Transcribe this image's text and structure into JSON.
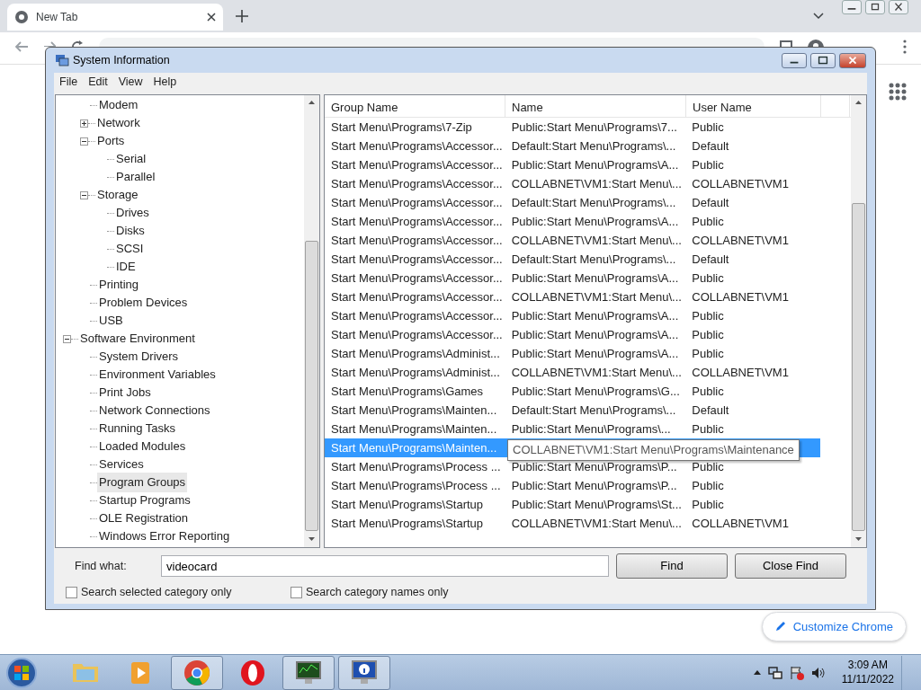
{
  "browser": {
    "tab": {
      "title": "New Tab",
      "selected": true
    },
    "customize_button": "Customize Chrome"
  },
  "window": {
    "title": "System Information",
    "menu": [
      "File",
      "Edit",
      "View",
      "Help"
    ],
    "tree": {
      "scrolled_parent": {
        "children": [
          {
            "label": "Modem",
            "selected": false
          },
          {
            "label": "Network",
            "expanded": false,
            "selected": false
          },
          {
            "label": "Ports",
            "expanded": true,
            "selected": false,
            "children": [
              {
                "label": "Serial",
                "selected": false
              },
              {
                "label": "Parallel",
                "selected": false
              }
            ]
          },
          {
            "label": "Storage",
            "expanded": true,
            "selected": false,
            "children": [
              {
                "label": "Drives",
                "selected": false
              },
              {
                "label": "Disks",
                "selected": false
              },
              {
                "label": "SCSI",
                "selected": false
              },
              {
                "label": "IDE",
                "selected": false
              }
            ]
          },
          {
            "label": "Printing",
            "selected": false
          },
          {
            "label": "Problem Devices",
            "selected": false
          },
          {
            "label": "USB",
            "selected": false
          }
        ]
      },
      "nodes": [
        {
          "label": "Software Environment",
          "expanded": true,
          "selected": false,
          "children": [
            {
              "label": "System Drivers",
              "selected": false
            },
            {
              "label": "Environment Variables",
              "selected": false
            },
            {
              "label": "Print Jobs",
              "selected": false
            },
            {
              "label": "Network Connections",
              "selected": false
            },
            {
              "label": "Running Tasks",
              "selected": false
            },
            {
              "label": "Loaded Modules",
              "selected": false
            },
            {
              "label": "Services",
              "selected": false
            },
            {
              "label": "Program Groups",
              "selected": true
            },
            {
              "label": "Startup Programs",
              "selected": false
            },
            {
              "label": "OLE Registration",
              "selected": false
            },
            {
              "label": "Windows Error Reporting",
              "selected": false
            }
          ]
        }
      ]
    },
    "table": {
      "columns": [
        "Group Name",
        "Name",
        "User Name"
      ],
      "rows": [
        {
          "group": "Start Menu\\Programs\\7-Zip",
          "name": "Public:Start Menu\\Programs\\7...",
          "user": "Public",
          "selected": false
        },
        {
          "group": "Start Menu\\Programs\\Accessor...",
          "name": "Default:Start Menu\\Programs\\...",
          "user": "Default",
          "selected": false
        },
        {
          "group": "Start Menu\\Programs\\Accessor...",
          "name": "Public:Start Menu\\Programs\\A...",
          "user": "Public",
          "selected": false
        },
        {
          "group": "Start Menu\\Programs\\Accessor...",
          "name": "COLLABNET\\VM1:Start Menu\\...",
          "user": "COLLABNET\\VM1",
          "selected": false
        },
        {
          "group": "Start Menu\\Programs\\Accessor...",
          "name": "Default:Start Menu\\Programs\\...",
          "user": "Default",
          "selected": false
        },
        {
          "group": "Start Menu\\Programs\\Accessor...",
          "name": "Public:Start Menu\\Programs\\A...",
          "user": "Public",
          "selected": false
        },
        {
          "group": "Start Menu\\Programs\\Accessor...",
          "name": "COLLABNET\\VM1:Start Menu\\...",
          "user": "COLLABNET\\VM1",
          "selected": false
        },
        {
          "group": "Start Menu\\Programs\\Accessor...",
          "name": "Default:Start Menu\\Programs\\...",
          "user": "Default",
          "selected": false
        },
        {
          "group": "Start Menu\\Programs\\Accessor...",
          "name": "Public:Start Menu\\Programs\\A...",
          "user": "Public",
          "selected": false
        },
        {
          "group": "Start Menu\\Programs\\Accessor...",
          "name": "COLLABNET\\VM1:Start Menu\\...",
          "user": "COLLABNET\\VM1",
          "selected": false
        },
        {
          "group": "Start Menu\\Programs\\Accessor...",
          "name": "Public:Start Menu\\Programs\\A...",
          "user": "Public",
          "selected": false
        },
        {
          "group": "Start Menu\\Programs\\Accessor...",
          "name": "Public:Start Menu\\Programs\\A...",
          "user": "Public",
          "selected": false
        },
        {
          "group": "Start Menu\\Programs\\Administ...",
          "name": "Public:Start Menu\\Programs\\A...",
          "user": "Public",
          "selected": false
        },
        {
          "group": "Start Menu\\Programs\\Administ...",
          "name": "COLLABNET\\VM1:Start Menu\\...",
          "user": "COLLABNET\\VM1",
          "selected": false
        },
        {
          "group": "Start Menu\\Programs\\Games",
          "name": "Public:Start Menu\\Programs\\G...",
          "user": "Public",
          "selected": false
        },
        {
          "group": "Start Menu\\Programs\\Mainten...",
          "name": "Default:Start Menu\\Programs\\...",
          "user": "Default",
          "selected": false
        },
        {
          "group": "Start Menu\\Programs\\Mainten...",
          "name": "Public:Start Menu\\Programs\\...",
          "user": "Public",
          "selected": false
        },
        {
          "group": "Start Menu\\Programs\\Mainten...",
          "selected": true
        },
        {
          "group": "Start Menu\\Programs\\Process ...",
          "name": "Public:Start Menu\\Programs\\P...",
          "user": "Public",
          "selected": false
        },
        {
          "group": "Start Menu\\Programs\\Process ...",
          "name": "Public:Start Menu\\Programs\\P...",
          "user": "Public",
          "selected": false
        },
        {
          "group": "Start Menu\\Programs\\Startup",
          "name": "Public:Start Menu\\Programs\\St...",
          "user": "Public",
          "selected": false
        },
        {
          "group": "Start Menu\\Programs\\Startup",
          "name": "COLLABNET\\VM1:Start Menu\\...",
          "user": "COLLABNET\\VM1",
          "selected": false
        }
      ]
    },
    "tooltip": "COLLABNET\\VM1:Start Menu\\Programs\\Maintenance",
    "find": {
      "label": "Find what:",
      "value": "videocard",
      "buttons": [
        "Find",
        "Close Find"
      ],
      "options": [
        {
          "label": "Search selected category only",
          "checked": false
        },
        {
          "label": "Search category names only",
          "checked": false
        }
      ]
    }
  },
  "taskbar": {
    "apps": [
      {
        "kind": "folder",
        "running": false
      },
      {
        "kind": "media",
        "running": false
      },
      {
        "kind": "chrome",
        "running": true
      },
      {
        "kind": "opera",
        "running": false
      },
      {
        "kind": "monitor",
        "running": true
      },
      {
        "kind": "sysinfo",
        "running": true
      }
    ],
    "clock": {
      "time": "3:09 AM",
      "date": "11/11/2022"
    }
  }
}
